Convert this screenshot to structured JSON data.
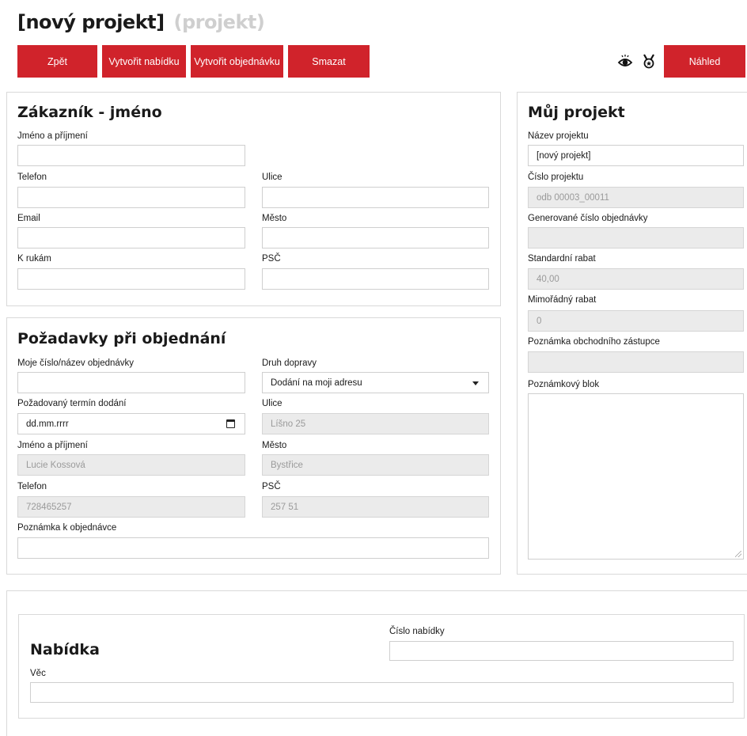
{
  "header": {
    "title": "[nový projekt]",
    "subtitle": "(projekt)"
  },
  "toolbar": {
    "back_label": "Zpět",
    "create_offer_label": "Vytvořit nabídku",
    "create_order_label": "Vytvořit objednávku",
    "delete_label": "Smazat",
    "preview_label": "Náhled"
  },
  "customer": {
    "title": "Zákazník - jméno",
    "name_label": "Jméno a příjmení",
    "name_value": "",
    "phone_label": "Telefon",
    "phone_value": "",
    "street_label": "Ulice",
    "street_value": "",
    "email_label": "Email",
    "email_value": "",
    "city_label": "Město",
    "city_value": "",
    "attention_label": "K rukám",
    "attention_value": "",
    "zip_label": "PSČ",
    "zip_value": ""
  },
  "order": {
    "title": "Požadavky při objednání",
    "my_order_label": "Moje číslo/název objednávky",
    "my_order_value": "",
    "transport_label": "Druh dopravy",
    "transport_value": "Dodání na moji adresu",
    "delivery_date_label": "Požadovaný termín dodání",
    "delivery_date_placeholder": "dd.mm.rrrr",
    "street_label": "Ulice",
    "street_value": "Líšno 25",
    "name_label": "Jméno a příjmení",
    "name_value": "Lucie Kossová",
    "city_label": "Město",
    "city_value": "Bystřice",
    "phone_label": "Telefon",
    "phone_value": "728465257",
    "zip_label": "PSČ",
    "zip_value": "257 51",
    "note_label": "Poznámka k objednávce",
    "note_value": ""
  },
  "project": {
    "title": "Můj projekt",
    "name_label": "Název projektu",
    "name_value": "[nový projekt]",
    "number_label": "Číslo projektu",
    "number_value": "odb 00003_00011",
    "generated_order_label": "Generované číslo objednávky",
    "generated_order_value": "",
    "std_discount_label": "Standardní rabat",
    "std_discount_value": "40,00",
    "extra_discount_label": "Mimořádný rabat",
    "extra_discount_value": "0",
    "sales_note_label": "Poznámka obchodního zástupce",
    "sales_note_value": "",
    "notepad_label": "Poznámkový blok",
    "notepad_value": ""
  },
  "offer": {
    "title": "Nabídka",
    "number_label": "Číslo nabídky",
    "number_value": "",
    "subject_label": "Věc",
    "subject_value": ""
  },
  "icons": {
    "eye": "eye-icon",
    "badge": "medal-icon"
  },
  "colors": {
    "accent": "#d0232b",
    "readonly_bg": "#ebebeb",
    "border": "#d9d9d9"
  }
}
